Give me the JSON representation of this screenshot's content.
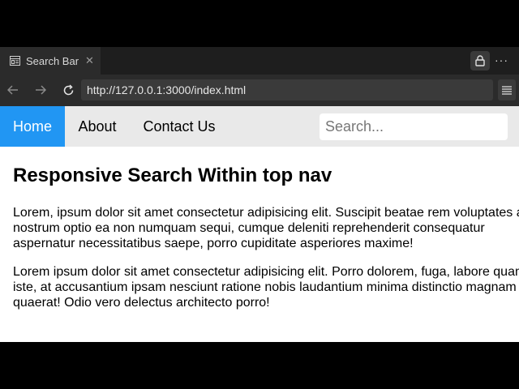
{
  "browser": {
    "tab_title": "Search Bar",
    "tab_close": "✕",
    "more_label": "···",
    "url": "http://127.0.0.1:3000/index.html"
  },
  "nav": {
    "links": [
      "Home",
      "About",
      "Contact Us"
    ],
    "active_index": 0,
    "search_placeholder": "Search..."
  },
  "content": {
    "heading": "Responsive Search Within top nav",
    "paragraphs": [
      "Lorem, ipsum dolor sit amet consectetur adipisicing elit. Suscipit beatae rem voluptates a, nostrum optio ea non numquam sequi, cumque deleniti reprehenderit consequatur aspernatur necessitatibus saepe, porro cupiditate asperiores maxime!",
      "Lorem ipsum dolor sit amet consectetur adipisicing elit. Porro dolorem, fuga, labore quam iste, at accusantium ipsam nesciunt ratione nobis laudantium minima distinctio magnam quaerat! Odio vero delectus architecto porro!"
    ]
  },
  "colors": {
    "accent": "#2196f3",
    "nav_bg": "#e9e9e9",
    "browser_chrome": "#2b2b2b"
  },
  "icons": [
    "tab-page-icon",
    "close-icon",
    "lock-icon",
    "more-icon",
    "back-arrow-icon",
    "forward-arrow-icon",
    "refresh-icon",
    "reader-menu-icon"
  ]
}
